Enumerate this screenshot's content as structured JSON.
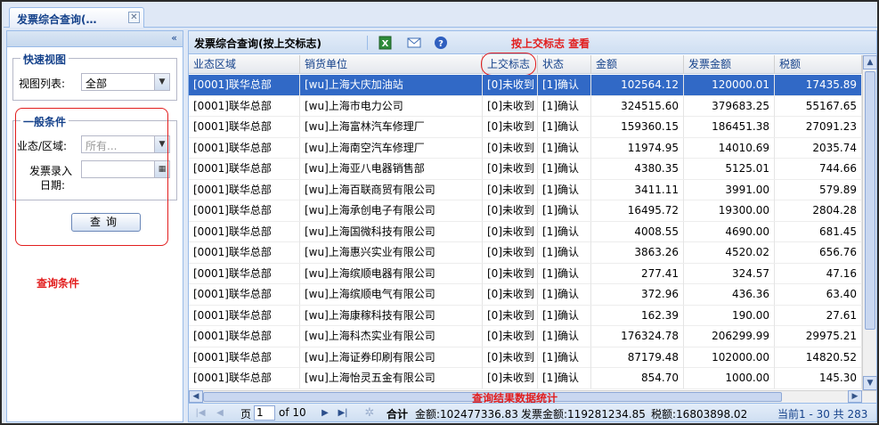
{
  "tab": {
    "label": "发票综合查询(…",
    "close": "✕"
  },
  "left": {
    "collapse": "«",
    "quick_view": {
      "legend": "快速视图",
      "list_label": "视图列表:",
      "list_value": "全部"
    },
    "general": {
      "legend": "一般条件",
      "region_label": "业态/区域:",
      "region_placeholder": "所有...",
      "date_label_1": "发票录入",
      "date_label_2": "日期:",
      "query_button": "查询"
    },
    "annotation": "查询条件"
  },
  "toolbar": {
    "title": "发票综合查询(按上交标志)",
    "annotation": "按上交标志 查看"
  },
  "columns": [
    "业态区域",
    "销货单位",
    "上交标志",
    "状态",
    "金额",
    "发票金额",
    "税额"
  ],
  "rows": [
    [
      "[0001]联华总部",
      "[wu]上海大庆加油站",
      "[0]未收到",
      "[1]确认",
      "102564.12",
      "120000.01",
      "17435.89"
    ],
    [
      "[0001]联华总部",
      "[wu]上海市电力公司",
      "[0]未收到",
      "[1]确认",
      "324515.60",
      "379683.25",
      "55167.65"
    ],
    [
      "[0001]联华总部",
      "[wu]上海富林汽车修理厂",
      "[0]未收到",
      "[1]确认",
      "159360.15",
      "186451.38",
      "27091.23"
    ],
    [
      "[0001]联华总部",
      "[wu]上海南空汽车修理厂",
      "[0]未收到",
      "[1]确认",
      "11974.95",
      "14010.69",
      "2035.74"
    ],
    [
      "[0001]联华总部",
      "[wu]上海亚八电器销售部",
      "[0]未收到",
      "[1]确认",
      "4380.35",
      "5125.01",
      "744.66"
    ],
    [
      "[0001]联华总部",
      "[wu]上海百联商贸有限公司",
      "[0]未收到",
      "[1]确认",
      "3411.11",
      "3991.00",
      "579.89"
    ],
    [
      "[0001]联华总部",
      "[wu]上海承创电子有限公司",
      "[0]未收到",
      "[1]确认",
      "16495.72",
      "19300.00",
      "2804.28"
    ],
    [
      "[0001]联华总部",
      "[wu]上海国微科技有限公司",
      "[0]未收到",
      "[1]确认",
      "4008.55",
      "4690.00",
      "681.45"
    ],
    [
      "[0001]联华总部",
      "[wu]上海惠兴实业有限公司",
      "[0]未收到",
      "[1]确认",
      "3863.26",
      "4520.02",
      "656.76"
    ],
    [
      "[0001]联华总部",
      "[wu]上海缤顺电器有限公司",
      "[0]未收到",
      "[1]确认",
      "277.41",
      "324.57",
      "47.16"
    ],
    [
      "[0001]联华总部",
      "[wu]上海缤顺电气有限公司",
      "[0]未收到",
      "[1]确认",
      "372.96",
      "436.36",
      "63.40"
    ],
    [
      "[0001]联华总部",
      "[wu]上海康稼科技有限公司",
      "[0]未收到",
      "[1]确认",
      "162.39",
      "190.00",
      "27.61"
    ],
    [
      "[0001]联华总部",
      "[wu]上海科杰实业有限公司",
      "[0]未收到",
      "[1]确认",
      "176324.78",
      "206299.99",
      "29975.21"
    ],
    [
      "[0001]联华总部",
      "[wu]上海证券印刷有限公司",
      "[0]未收到",
      "[1]确认",
      "87179.48",
      "102000.00",
      "14820.52"
    ],
    [
      "[0001]联华总部",
      "[wu]上海怡灵五金有限公司",
      "[0]未收到",
      "[1]确认",
      "854.70",
      "1000.00",
      "145.30"
    ]
  ],
  "summary_annotation": "查询结果数据统计",
  "pager": {
    "page_label": "页",
    "page_value": "1",
    "of_label": "of 10",
    "total_label": "合计",
    "amount": "金额:102477336.83",
    "invoice_amount": "发票金额:119281234.85",
    "tax": "税额:16803898.02",
    "display": "当前1 - 30 共 283"
  },
  "colors": {
    "accent_red": "#e21e1e",
    "selected_row": "#3169c6",
    "header_blue": "#15428b"
  }
}
